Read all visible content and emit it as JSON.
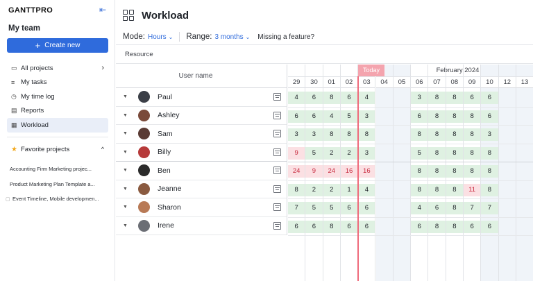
{
  "sidebar": {
    "logo": "GANTTPRO",
    "team_title": "My team",
    "create_label": "Create new",
    "nav": [
      {
        "label": "All projects"
      },
      {
        "label": "My tasks"
      },
      {
        "label": "My time log"
      },
      {
        "label": "Reports"
      },
      {
        "label": "Workload"
      }
    ],
    "favorites_label": "Favorite projects",
    "favorites": [
      "Accounting Firm Marketing projec...",
      "Product Marketing Plan Template a...",
      "Event Timeline, Mobile developmen..."
    ]
  },
  "header": {
    "title": "Workload",
    "mode_label": "Mode:",
    "mode_value": "Hours",
    "range_label": "Range:",
    "range_value": "3 months",
    "missing_feature": "Missing a feature?",
    "resource_label": "Resource"
  },
  "grid": {
    "user_col_header": "User name",
    "today_label": "Today",
    "month_label": "February 2024",
    "days": [
      "29",
      "30",
      "01",
      "02",
      "03",
      "04",
      "05",
      "06",
      "07",
      "08",
      "09",
      "10",
      "12",
      "13"
    ],
    "weekend_days": [
      "04",
      "05",
      "10",
      "12",
      "13"
    ],
    "users": [
      {
        "name": "Paul",
        "hours": [
          4,
          6,
          8,
          6,
          4,
          null,
          null,
          3,
          8,
          8,
          6,
          6
        ]
      },
      {
        "name": "Ashley",
        "hours": [
          6,
          6,
          4,
          5,
          3,
          null,
          null,
          6,
          8,
          8,
          8,
          6
        ]
      },
      {
        "name": "Sam",
        "hours": [
          3,
          3,
          8,
          8,
          8,
          null,
          null,
          8,
          8,
          8,
          8,
          3
        ]
      },
      {
        "name": "Billy",
        "hours": [
          9,
          5,
          2,
          2,
          3,
          null,
          null,
          5,
          8,
          8,
          8,
          8
        ]
      },
      {
        "name": "Ben",
        "hours": [
          24,
          9,
          24,
          16,
          16,
          null,
          null,
          8,
          8,
          8,
          8,
          8
        ]
      },
      {
        "name": "Jeanne",
        "hours": [
          8,
          2,
          2,
          1,
          4,
          null,
          null,
          8,
          8,
          8,
          11,
          8
        ]
      },
      {
        "name": "Sharon",
        "hours": [
          7,
          5,
          5,
          6,
          6,
          null,
          null,
          4,
          6,
          8,
          7,
          7
        ]
      },
      {
        "name": "Irene",
        "hours": [
          6,
          6,
          8,
          6,
          6,
          null,
          null,
          6,
          8,
          8,
          6,
          6
        ]
      }
    ],
    "capacity_hours": 8,
    "colors": {
      "ok": "#dff1e2",
      "over": "#fbe0e3",
      "over_text": "#c8293e",
      "today": "#ef6a7b",
      "accent": "#2f6bdc"
    }
  }
}
